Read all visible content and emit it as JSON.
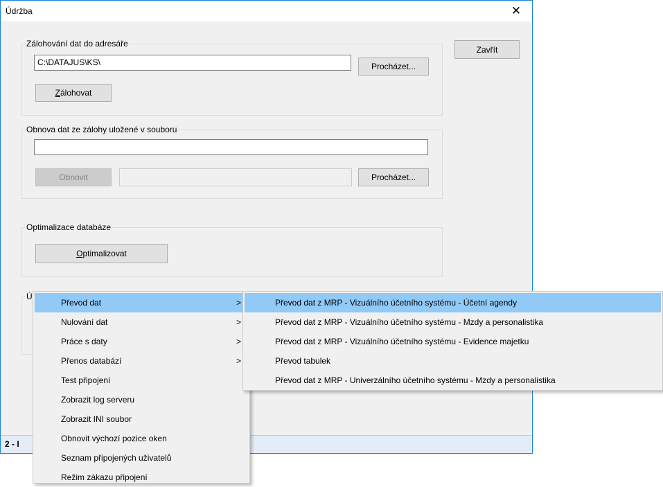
{
  "window": {
    "title": "Údržba",
    "close_glyph": "✕",
    "close_button": "Zavřít"
  },
  "backup": {
    "legend": "Zálohování dat do adresáře",
    "path": "C:\\DATAJUS\\KS\\",
    "browse": "Procházet...",
    "action_accel": "Z",
    "action_rest": "álohovat"
  },
  "restore": {
    "legend": "Obnova dat ze zálohy uložené v souboru",
    "file": "",
    "action": "Obnovit",
    "secondary": "",
    "browse": "Procházet..."
  },
  "optimize": {
    "legend": "Optimalizace databáze",
    "action_accel": "O",
    "action_rest": "ptimalizovat"
  },
  "hidden_group": {
    "legend_fragment": "Ú"
  },
  "status": {
    "text_fragment": "2 - I"
  },
  "context_menu": {
    "items": [
      {
        "label": "Převod dat",
        "has_submenu": true,
        "highlighted": true
      },
      {
        "label": "Nulování dat",
        "has_submenu": true
      },
      {
        "label": "Práce s daty",
        "has_submenu": true
      },
      {
        "label": "Přenos databází",
        "has_submenu": true
      },
      {
        "label": "Test připojení"
      },
      {
        "label": "Zobrazit log serveru"
      },
      {
        "label": "Zobrazit INI soubor"
      },
      {
        "label": "Obnovit výchozí pozice oken"
      },
      {
        "label": "Seznam připojených uživatelů"
      },
      {
        "label": "Režim zákazu připojení"
      }
    ],
    "arrow_glyph": ">"
  },
  "submenu": {
    "items": [
      {
        "label": "Převod dat z MRP - Vizuálního účetního systému - Účetní agendy",
        "highlighted": true
      },
      {
        "label": "Převod dat z MRP - Vizuálního účetního systému - Mzdy a personalistika"
      },
      {
        "label": "Převod dat z MRP - Vizuálního účetního systému - Evidence majetku"
      },
      {
        "label": "Převod tabulek"
      },
      {
        "label": "Převod dat z MRP - Univerzálního účetního systému - Mzdy a personalistika"
      }
    ]
  },
  "colors": {
    "window_border": "#1883d7",
    "highlight": "#91c9f7",
    "statusbar": "#e4ecf7",
    "face": "#f0f0f0"
  }
}
